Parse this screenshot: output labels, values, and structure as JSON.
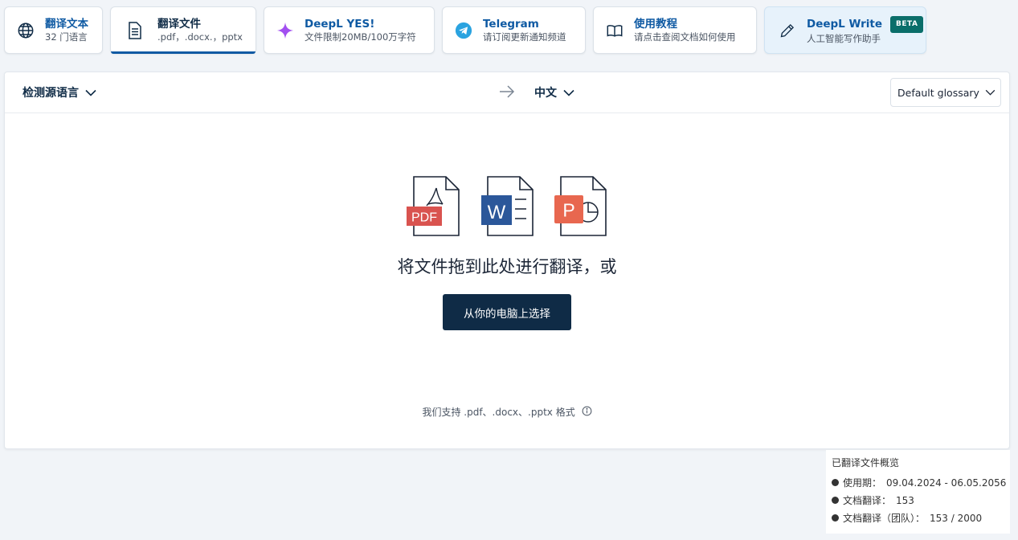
{
  "tabs": [
    {
      "title": "翻译文本",
      "subtitle": "32 门语言",
      "icon": "globe-icon"
    },
    {
      "title": "翻译文件",
      "subtitle": ".pdf，.docx.，pptx",
      "icon": "document-icon"
    },
    {
      "title": "DeepL YES!",
      "subtitle": "文件限制20MB/100万字符",
      "icon": "sparkle-icon"
    },
    {
      "title": "Telegram",
      "subtitle": "请订阅更新通知频道",
      "icon": "telegram-icon"
    },
    {
      "title": "使用教程",
      "subtitle": "请点击查阅文档如何使用",
      "icon": "book-icon"
    },
    {
      "title": "DeepL Write",
      "subtitle": "人工智能写作助手",
      "badge": "BETA",
      "icon": "pencil-icon"
    }
  ],
  "translator": {
    "source_language": "检测源语言",
    "target_language": "中文",
    "glossary": "Default glossary",
    "file_badges": {
      "pdf": "PDF",
      "word": "W",
      "ppt": "P"
    },
    "drop_text": "将文件拖到此处进行翻译，或",
    "choose_button": "从你的电脑上选择",
    "support_text": "我们支持 .pdf、.docx、.pptx 格式"
  },
  "usage": {
    "title": "已翻译文件概览",
    "rows": [
      {
        "label": "使用期：",
        "value": "09.04.2024 - 06.05.2056"
      },
      {
        "label": "文档翻译：",
        "value": "153"
      },
      {
        "label": "文档翻译（团队）：",
        "value": "153 / 2000"
      }
    ]
  },
  "colors": {
    "brand_navy": "#0f2b46",
    "accent_blue": "#0f5aa3",
    "pdf_red": "#d9534f",
    "word_blue": "#2b579a",
    "ppt_orange": "#e8674f",
    "sparkle_purple": "#a24ff0",
    "telegram_blue": "#2aa3e0",
    "beta_teal": "#0a6e6a"
  }
}
